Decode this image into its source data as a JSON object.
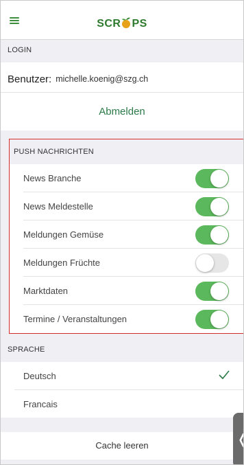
{
  "header": {
    "logo_part1": "SCR",
    "logo_part2": "PS",
    "menu_icon": "hamburger-menu-icon"
  },
  "login": {
    "section_title": "LOGIN",
    "user_label": "Benutzer:",
    "user_value": "michelle.koenig@szg.ch",
    "logout_label": "Abmelden"
  },
  "push": {
    "section_title": "PUSH NACHRICHTEN",
    "items": [
      {
        "label": "News Branche",
        "enabled": true
      },
      {
        "label": "News Meldestelle",
        "enabled": true
      },
      {
        "label": "Meldungen Gemüse",
        "enabled": true
      },
      {
        "label": "Meldungen Früchte",
        "enabled": false
      },
      {
        "label": "Marktdaten",
        "enabled": true
      },
      {
        "label": "Termine / Veranstaltungen",
        "enabled": true
      }
    ]
  },
  "language": {
    "section_title": "SPRACHE",
    "options": [
      {
        "label": "Deutsch",
        "selected": true
      },
      {
        "label": "Francais",
        "selected": false
      }
    ]
  },
  "cache": {
    "label": "Cache leeren"
  },
  "side_tab": {
    "glyph": "❬"
  },
  "colors": {
    "accent_green": "#5cb85c",
    "logo_green": "#2d7a2d",
    "highlight_red": "#d42d2d"
  }
}
